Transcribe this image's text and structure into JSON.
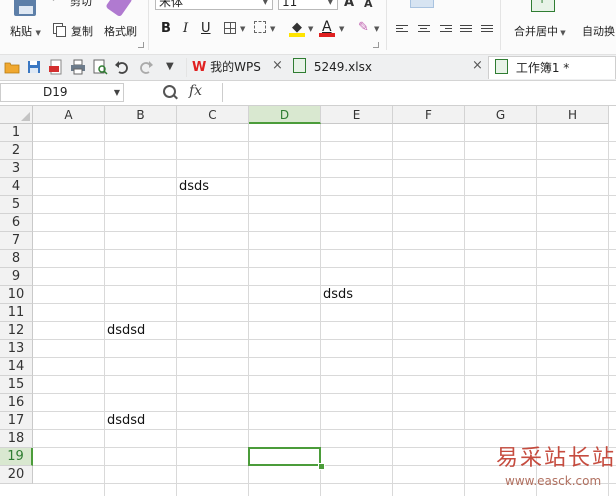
{
  "ribbon": {
    "cut_label": "剪切",
    "paste_label": "粘贴",
    "copy_label": "复制",
    "format_painter_label": "格式刷",
    "font_name": "宋体",
    "font_size": "11",
    "bold": "B",
    "italic": "I",
    "underline": "U",
    "font_color_glyph": "A",
    "grow_font": "A",
    "shrink_font": "A",
    "merge_center_label": "合并居中",
    "auto_wrap_label": "自动换"
  },
  "tabbar": {
    "tabs": [
      {
        "label": "我的WPS"
      },
      {
        "label": "5249.xlsx"
      },
      {
        "label": "工作簿1 *"
      }
    ],
    "active_tab": 2
  },
  "formula_bar": {
    "name_box": "D19",
    "fx_label": "fx",
    "formula": ""
  },
  "sheet": {
    "columns": [
      "A",
      "B",
      "C",
      "D",
      "E",
      "F",
      "G",
      "H"
    ],
    "rows": [
      "1",
      "2",
      "3",
      "4",
      "5",
      "6",
      "7",
      "8",
      "9",
      "10",
      "11",
      "12",
      "13",
      "14",
      "15",
      "16",
      "17",
      "18",
      "19",
      "20"
    ],
    "selected_column": "D",
    "selected_row": "19",
    "cells": [
      {
        "ref": "C4",
        "value": "dsds"
      },
      {
        "ref": "E10",
        "value": "dsds"
      },
      {
        "ref": "B12",
        "value": "dsdsd"
      },
      {
        "ref": "B17",
        "value": "dsdsd"
      }
    ]
  },
  "watermark": {
    "text": "易采站长站",
    "url": "www.easck.com"
  },
  "colors": {
    "accent_green": "#4b9c3a",
    "header_bg": "#f2f2f2",
    "wps_red": "#e02020"
  }
}
